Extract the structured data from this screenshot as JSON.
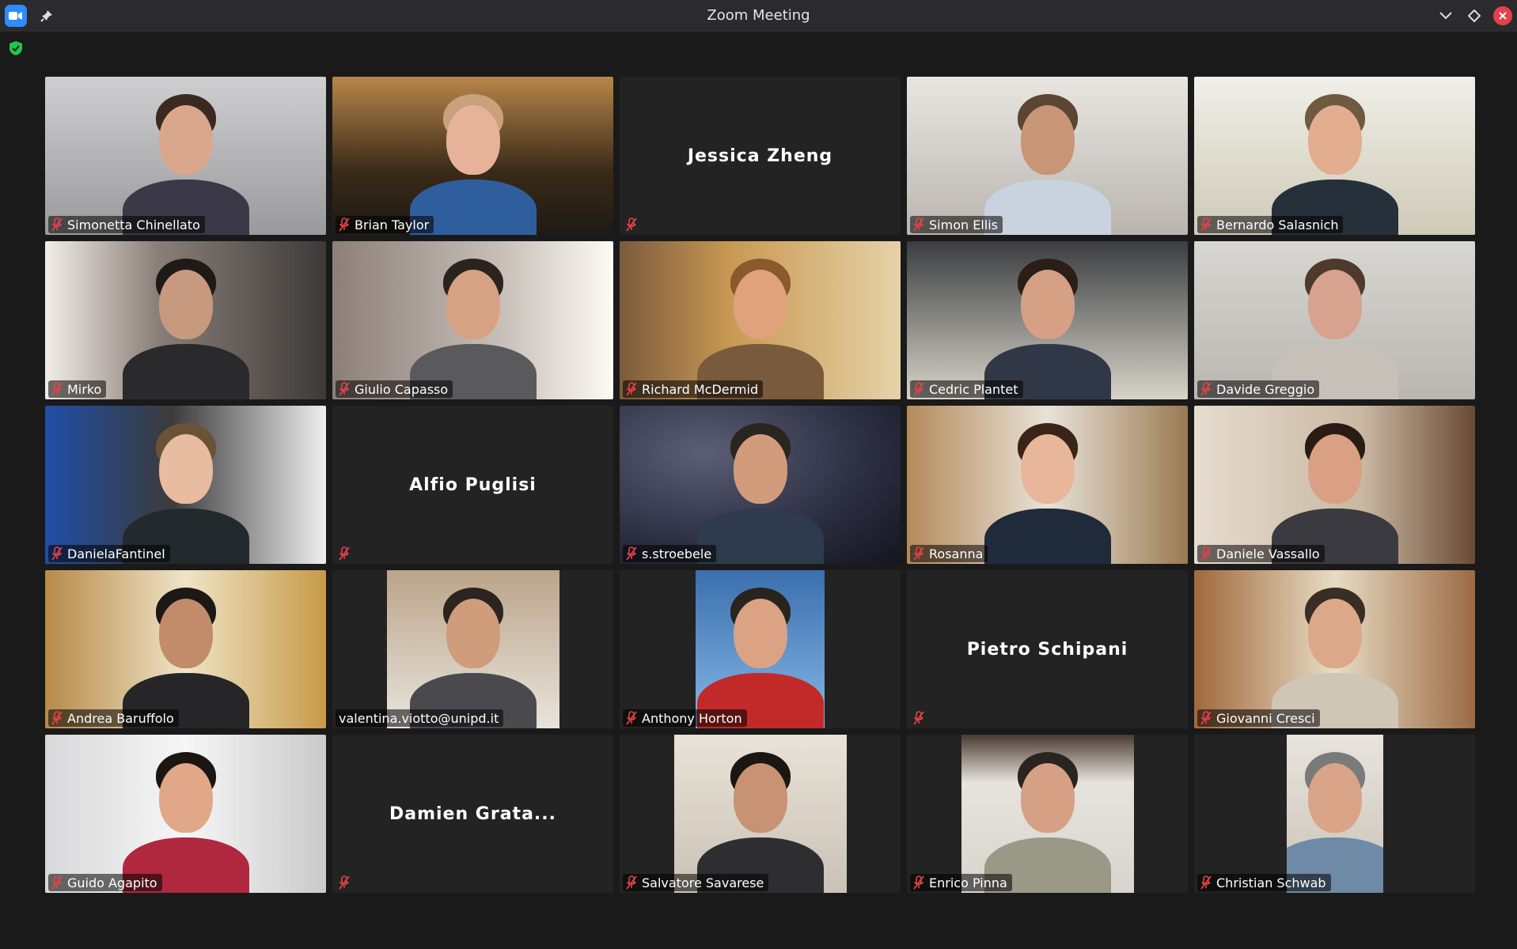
{
  "window": {
    "title": "Zoom Meeting",
    "accent": "#2d8cff",
    "active_speaker_border": "#23d959",
    "mute_icon_color": "#e5414a"
  },
  "titlebar_icons": [
    "zoom-logo-icon",
    "pin-icon",
    "chevron-down-icon",
    "diamond-icon",
    "close-icon"
  ],
  "security_icon": "shield-check-icon",
  "participants": [
    {
      "name": "Simonetta Chinellato",
      "video": true,
      "muted": true,
      "active": false
    },
    {
      "name": "Brian Taylor",
      "video": true,
      "muted": true,
      "active": false
    },
    {
      "name": "Jessica Zheng",
      "video": false,
      "muted": true,
      "active": false
    },
    {
      "name": "Simon Ellis",
      "video": true,
      "muted": true,
      "active": false
    },
    {
      "name": "Bernardo Salasnich",
      "video": true,
      "muted": true,
      "active": false
    },
    {
      "name": "Mirko",
      "video": true,
      "muted": true,
      "active": false
    },
    {
      "name": "Giulio Capasso",
      "video": true,
      "muted": true,
      "active": false
    },
    {
      "name": "Richard McDermid",
      "video": true,
      "muted": true,
      "active": true
    },
    {
      "name": "Cedric Plantet",
      "video": true,
      "muted": true,
      "active": false
    },
    {
      "name": "Davide Greggio",
      "video": true,
      "muted": true,
      "active": false
    },
    {
      "name": "DanielaFantinel",
      "video": true,
      "muted": true,
      "active": false
    },
    {
      "name": "Alfio Puglisi",
      "video": false,
      "muted": true,
      "active": false
    },
    {
      "name": "s.stroebele",
      "video": true,
      "muted": true,
      "active": false
    },
    {
      "name": "Rosanna",
      "video": true,
      "muted": true,
      "active": false
    },
    {
      "name": "Daniele Vassallo",
      "video": true,
      "muted": true,
      "active": false
    },
    {
      "name": "Andrea Baruffolo",
      "video": true,
      "muted": true,
      "active": false
    },
    {
      "name": "valentina.viotto@unipd.it",
      "video": true,
      "muted": false,
      "active": false
    },
    {
      "name": "Anthony Horton",
      "video": true,
      "muted": true,
      "active": false
    },
    {
      "name": "Pietro Schipani",
      "video": false,
      "muted": true,
      "active": false
    },
    {
      "name": "Giovanni Cresci",
      "video": true,
      "muted": true,
      "active": false
    },
    {
      "name": "Guido Agapito",
      "video": true,
      "muted": true,
      "active": false
    },
    {
      "name": "Damien Grata...",
      "video": false,
      "muted": true,
      "active": false
    },
    {
      "name": "Salvatore Savarese",
      "video": true,
      "muted": true,
      "active": false
    },
    {
      "name": "Enrico Pinna",
      "video": true,
      "muted": true,
      "active": false
    },
    {
      "name": "Christian Schwab",
      "video": true,
      "muted": true,
      "active": false
    }
  ]
}
